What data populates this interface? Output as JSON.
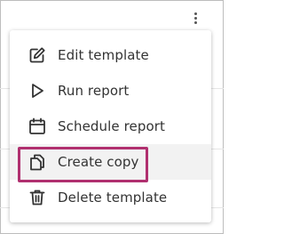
{
  "menu": {
    "items": [
      {
        "label": "Edit template",
        "icon": "edit-icon"
      },
      {
        "label": "Run report",
        "icon": "play-icon"
      },
      {
        "label": "Schedule report",
        "icon": "calendar-icon"
      },
      {
        "label": "Create copy",
        "icon": "copy-icon",
        "highlighted": true
      },
      {
        "label": "Delete template",
        "icon": "trash-icon"
      }
    ]
  },
  "colors": {
    "highlight_border": "#b0306f",
    "text": "#333333",
    "hover_background": "#f2f2f2"
  }
}
